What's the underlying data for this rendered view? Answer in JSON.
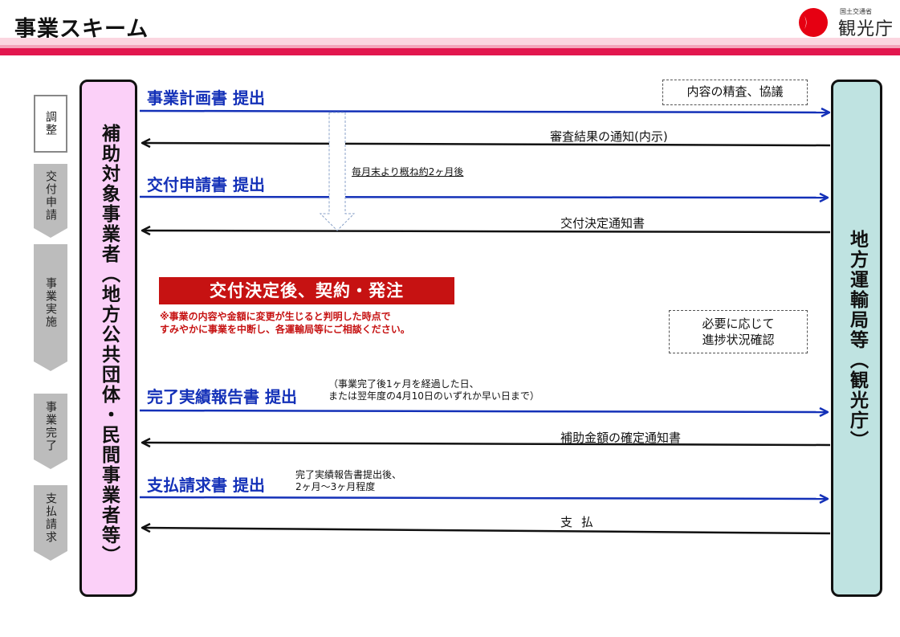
{
  "page": {
    "title": "事業スキーム"
  },
  "logo": {
    "agency": "国土交通省",
    "name": "観光庁"
  },
  "phases": [
    {
      "label": "調整"
    },
    {
      "label": "交付申請"
    },
    {
      "label": "事業実施"
    },
    {
      "label": "事業完了"
    },
    {
      "label": "支払請求"
    }
  ],
  "actors": {
    "left": "補助対象事業者（地方公共団体・民間事業者等）",
    "right": "地方運輸局等（観光庁）"
  },
  "flows": {
    "plan_submit": "事業計画書 提出",
    "plan_review": "内容の精査、協議",
    "review_result": "審査結果の通知(内示)",
    "period_note": "毎月末より概ね約2ヶ月後",
    "grant_apply": "交付申請書 提出",
    "grant_decision": "交付決定通知書",
    "contract_banner": "交付決定後、契約・発注",
    "contract_warning_1": "※事業の内容や金額に変更が生じると判明した時点で",
    "contract_warning_2": "すみやかに事業を中断し、各運輸局等にご相談ください。",
    "progress_1": "必要に応じて",
    "progress_2": "進捗状況確認",
    "completion_submit": "完了実績報告書 提出",
    "completion_note_1": "（事業完了後1ヶ月を経過した日、",
    "completion_note_2": "または翌年度の4月10日のいずれか早い日まで）",
    "amount_confirm": "補助金額の確定通知書",
    "payment_request": "支払請求書 提出",
    "payment_note_1": "完了実績報告書提出後、",
    "payment_note_2": "2ヶ月～3ヶ月程度",
    "payment": "支 払"
  },
  "colors": {
    "accent_red": "#e2174e",
    "blue": "#1431b8",
    "left_fill": "#fbd0f8",
    "right_fill": "#bfe3e1"
  }
}
